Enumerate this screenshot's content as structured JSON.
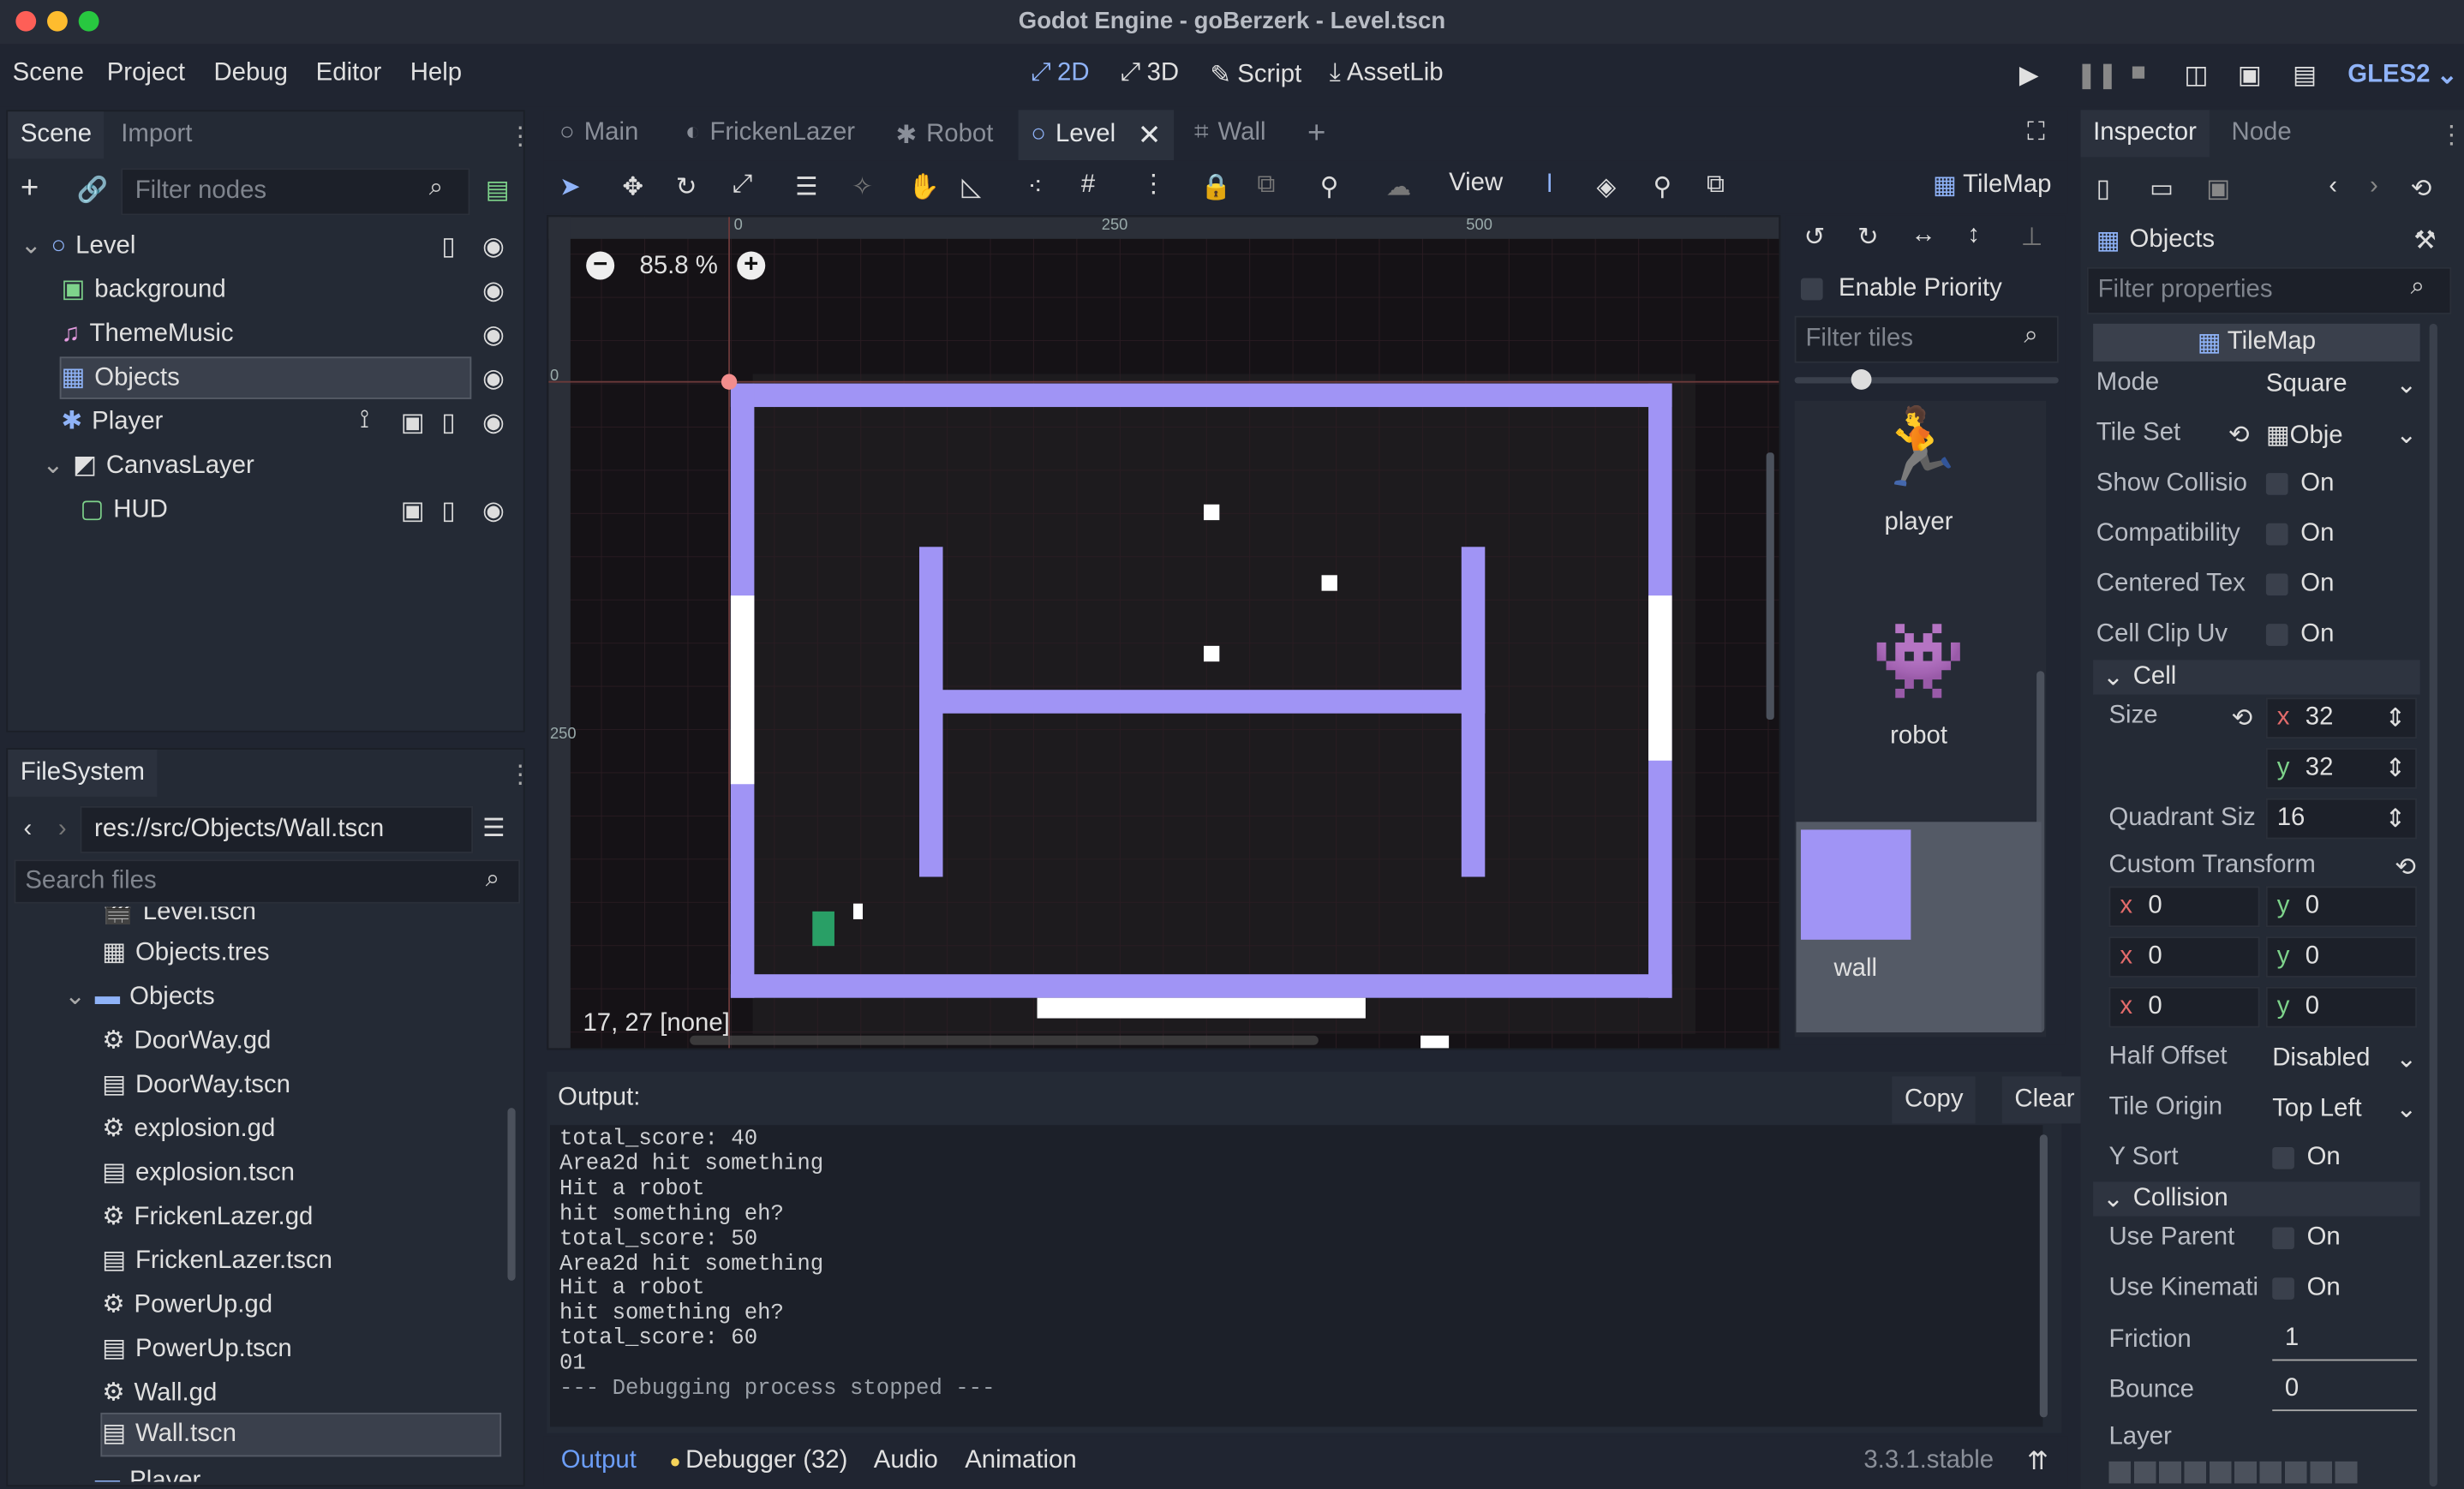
{
  "window": {
    "title": "Godot Engine - goBerzerk - Level.tscn"
  },
  "menu": [
    "Scene",
    "Project",
    "Debug",
    "Editor",
    "Help"
  ],
  "workspaces": [
    "2D",
    "3D",
    "Script",
    "AssetLib"
  ],
  "renderer": "GLES2",
  "scene_dock": {
    "tabs": [
      "Scene",
      "Import"
    ],
    "filter_placeholder": "Filter nodes",
    "nodes": [
      "Level",
      "background",
      "ThemeMusic",
      "Objects",
      "Player",
      "CanvasLayer",
      "HUD"
    ]
  },
  "filesystem": {
    "tab": "FileSystem",
    "path": "res://src/Objects/Wall.tscn",
    "search_placeholder": "Search files",
    "items": [
      "Level.tscn",
      "Objects.tres",
      "Objects",
      "DoorWay.gd",
      "DoorWay.tscn",
      "explosion.gd",
      "explosion.tscn",
      "FrickenLazer.gd",
      "FrickenLazer.tscn",
      "PowerUp.gd",
      "PowerUp.tscn",
      "Wall.gd",
      "Wall.tscn",
      "Player"
    ]
  },
  "scene_tabs": [
    "Main",
    "FrickenLazer",
    "Robot",
    "Level",
    "Wall"
  ],
  "toolbar": {
    "view": "View",
    "tilemap": "TileMap"
  },
  "viewport": {
    "zoom": "85.8 %",
    "status": "17, 27 [none]",
    "ruler_top": [
      "0",
      "250",
      "500"
    ],
    "ruler_left": [
      "0",
      "250"
    ]
  },
  "tile_panel": {
    "enable_priority": "Enable Priority",
    "filter_placeholder": "Filter tiles",
    "tiles": [
      "player",
      "robot",
      "wall"
    ]
  },
  "output": {
    "title": "Output:",
    "copy": "Copy",
    "clear": "Clear",
    "lines": [
      "total_score: 40",
      "Area2d hit something",
      "Hit a robot",
      "hit something eh?",
      "total_score: 50",
      "Area2d hit something",
      "Hit a robot",
      "hit something eh?",
      "total_score: 60",
      "01",
      "--- Debugging process stopped ---"
    ]
  },
  "bottom_tabs": [
    "Output",
    "Debugger (32)",
    "Audio",
    "Animation"
  ],
  "version": "3.3.1.stable",
  "inspector": {
    "tabs": [
      "Inspector",
      "Node"
    ],
    "object": "Objects",
    "filter_placeholder": "Filter properties",
    "class": "TileMap",
    "mode_label": "Mode",
    "mode": "Square",
    "tileset_label": "Tile Set",
    "tileset": "Obje",
    "show_collision": "Show Collisio",
    "compatibility": "Compatibility",
    "centered_tex": "Centered Tex",
    "cell_clip_uv": "Cell Clip Uv",
    "on": "On",
    "cell_section": "Cell",
    "size_label": "Size",
    "size_x": "32",
    "size_y": "32",
    "axis_x": "x",
    "axis_y": "y",
    "quadrant_label": "Quadrant Siz",
    "quadrant": "16",
    "custom_transform": "Custom Transform",
    "transform": [
      "0",
      "0",
      "0",
      "0",
      "0",
      "0"
    ],
    "half_offset_label": "Half Offset",
    "half_offset": "Disabled",
    "tile_origin_label": "Tile Origin",
    "tile_origin": "Top Left",
    "y_sort": "Y Sort",
    "collision_section": "Collision",
    "use_parent": "Use Parent",
    "use_kinematic": "Use Kinemati",
    "friction_label": "Friction",
    "friction": "1",
    "bounce_label": "Bounce",
    "bounce": "0",
    "layer_label": "Layer"
  },
  "colors": {
    "accent": "#6c9ef8",
    "wall": "#a094f5",
    "bg": "#202531"
  }
}
